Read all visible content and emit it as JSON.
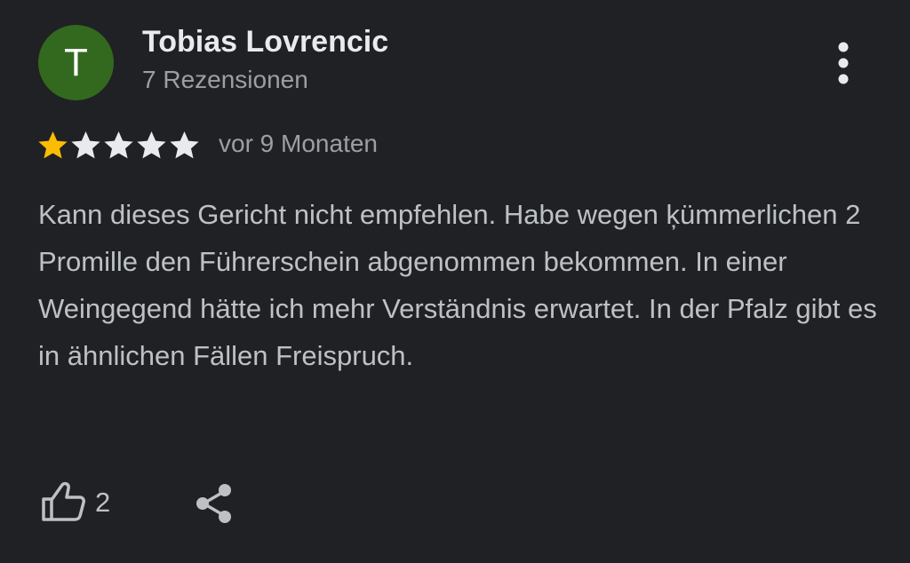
{
  "review": {
    "avatar_initial": "T",
    "avatar_color": "#33691e",
    "author_name": "Tobias Lovrencic",
    "review_count": "7 Rezensionen",
    "rating": 1,
    "rating_max": 5,
    "time_ago": "vor 9 Monaten",
    "text": "Kann dieses Gericht nicht empfehlen. Habe wegen ķümmerlichen 2 Promille den Führerschein abgenommen bekommen. In einer Weingegend hätte ich mehr Verständnis erwartet. In der Pfalz gibt es in ähnlichen Fällen Freispruch.",
    "like_count": "2"
  },
  "icons": {
    "more": "more-vert-icon",
    "like": "thumbs-up-icon",
    "share": "share-icon",
    "star": "star-icon"
  },
  "colors": {
    "background": "#202124",
    "star_filled": "#fbbc04",
    "star_empty": "#e8eaed",
    "primary_text": "#e8eaed",
    "secondary_text": "#9aa0a6",
    "body_text": "#bdc1c6"
  }
}
